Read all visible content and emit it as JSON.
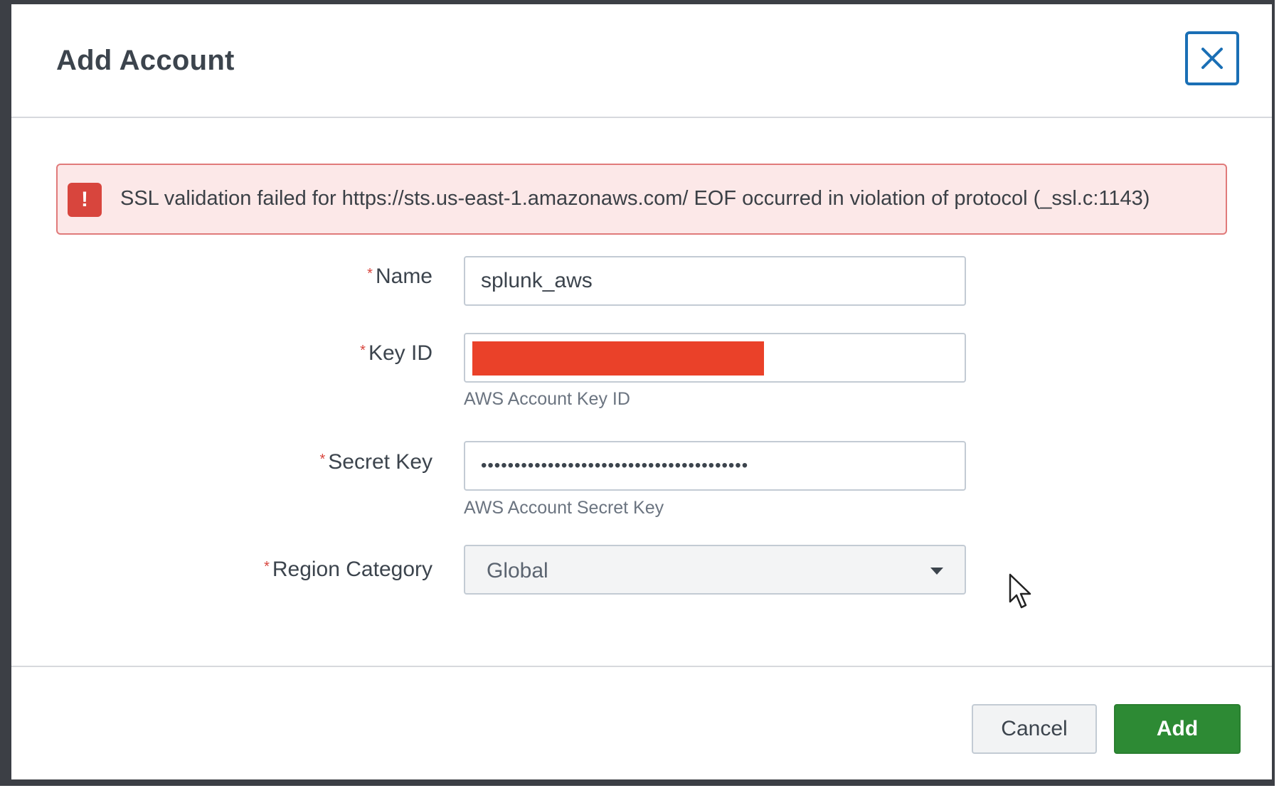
{
  "modal": {
    "title": "Add Account",
    "close_icon": "close-icon"
  },
  "alert": {
    "icon": "error-icon",
    "icon_glyph": "!",
    "message": "SSL validation failed for https://sts.us-east-1.amazonaws.com/ EOF occurred in violation of protocol (_ssl.c:1143)"
  },
  "form": {
    "required_marker": "*",
    "name": {
      "label": "Name",
      "value": "splunk_aws"
    },
    "key_id": {
      "label": "Key ID",
      "value": "",
      "help": "AWS Account Key ID",
      "redacted": true
    },
    "secret_key": {
      "label": "Secret Key",
      "value": "••••••••••••••••••••••••••••••••••••••••",
      "help": "AWS Account Secret Key"
    },
    "region_category": {
      "label": "Region Category",
      "selected": "Global",
      "icon": "caret-down-icon"
    }
  },
  "footer": {
    "cancel_label": "Cancel",
    "add_label": "Add"
  },
  "colors": {
    "primary_blue": "#1a6fb5",
    "error_red": "#d8453d",
    "alert_bg": "#fce8e8",
    "success_green": "#2d8a34",
    "redaction": "#ea4129"
  }
}
